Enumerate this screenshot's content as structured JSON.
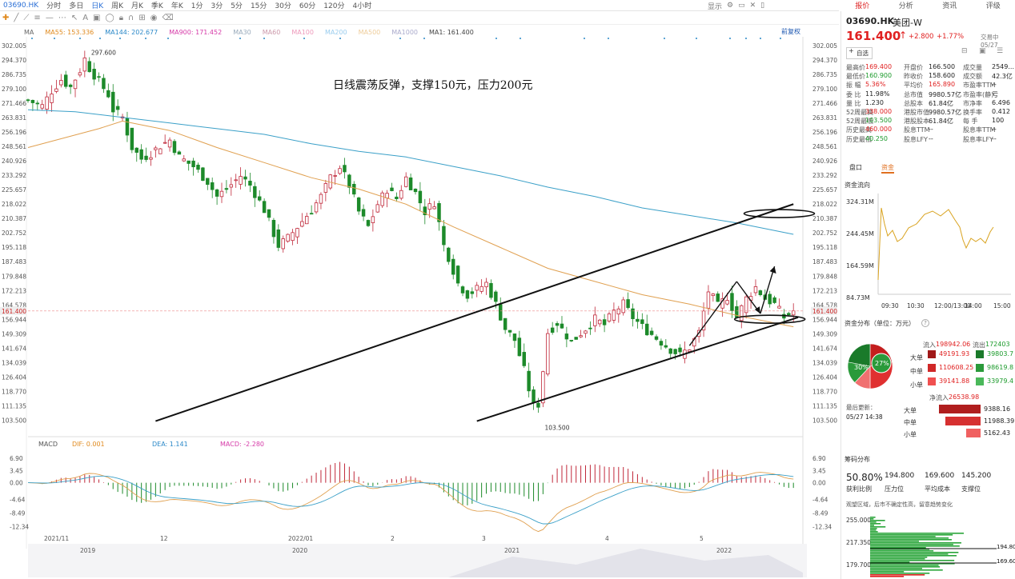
{
  "topbar": {
    "code": "03690.HK",
    "periods": [
      "分时",
      "多日",
      "日K",
      "周K",
      "月K",
      "季K",
      "年K",
      "1分",
      "3分",
      "5分",
      "15分",
      "30分",
      "60分",
      "120分",
      "4小时"
    ],
    "active_period": "日K",
    "right_menu": "显示",
    "panel_tabs": [
      "报价",
      "分析",
      "资讯",
      "评级"
    ]
  },
  "ma_bar": {
    "label": "MA",
    "items": [
      {
        "text": "MA55: 153.336",
        "color": "#e08a1e"
      },
      {
        "text": "MA144: 202.677",
        "color": "#2a88c8"
      },
      {
        "text": "MA900: 171.452",
        "color": "#d63aa8"
      },
      {
        "text": "MA30",
        "color": "#9ab"
      },
      {
        "text": "MA60",
        "color": "#c9a"
      },
      {
        "text": "MA100",
        "color": "#e9b"
      },
      {
        "text": "MA200",
        "color": "#9ce"
      },
      {
        "text": "MA500",
        "color": "#ec9"
      },
      {
        "text": "MA1000",
        "color": "#aac"
      },
      {
        "text": "MA1: 161.400",
        "color": "#444"
      }
    ],
    "adjust": "前复权"
  },
  "annotation": "日线震荡反弹，支撑150元，压力200元",
  "chart_data": [
    {
      "type": "candlestick",
      "title": "",
      "y_ticks": [
        302.005,
        294.37,
        286.735,
        279.1,
        271.466,
        263.831,
        256.196,
        248.561,
        240.926,
        233.292,
        225.657,
        218.022,
        210.387,
        202.752,
        195.118,
        187.483,
        179.848,
        172.213,
        164.578,
        156.944,
        149.309,
        141.674,
        134.039,
        126.404,
        118.77,
        111.135,
        103.5
      ],
      "ylim": [
        99,
        305
      ],
      "last_price": 161.4,
      "high_label": 297.6,
      "low_label": 103.5,
      "x_top_labels": [
        "2021/11",
        "12",
        "2022/01",
        "2",
        "3",
        "4",
        "5"
      ],
      "x_bottom_labels": [
        "2019",
        "2020",
        "2021",
        "2022"
      ],
      "close_path": [
        [
          0,
          273
        ],
        [
          3,
          270
        ],
        [
          5,
          278
        ],
        [
          7,
          284
        ],
        [
          9,
          280
        ],
        [
          11,
          289
        ],
        [
          12,
          295
        ],
        [
          13,
          290
        ],
        [
          15,
          283
        ],
        [
          17,
          276
        ],
        [
          18,
          268
        ],
        [
          20,
          264
        ],
        [
          22,
          248
        ],
        [
          24,
          242
        ],
        [
          26,
          245
        ],
        [
          28,
          249
        ],
        [
          30,
          252
        ],
        [
          32,
          243
        ],
        [
          35,
          238
        ],
        [
          38,
          230
        ],
        [
          40,
          222
        ],
        [
          42,
          226
        ],
        [
          45,
          233
        ],
        [
          47,
          228
        ],
        [
          50,
          215
        ],
        [
          53,
          196
        ],
        [
          55,
          200
        ],
        [
          57,
          206
        ],
        [
          60,
          215
        ],
        [
          62,
          222
        ],
        [
          64,
          232
        ],
        [
          66,
          238
        ],
        [
          68,
          228
        ],
        [
          70,
          214
        ],
        [
          72,
          206
        ],
        [
          74,
          218
        ],
        [
          76,
          226
        ],
        [
          78,
          221
        ],
        [
          80,
          232
        ],
        [
          82,
          224
        ],
        [
          84,
          214
        ],
        [
          86,
          219
        ],
        [
          87,
          208
        ],
        [
          88,
          196
        ],
        [
          89,
          190
        ],
        [
          90,
          183
        ],
        [
          91,
          176
        ],
        [
          93,
          170
        ],
        [
          95,
          173
        ],
        [
          97,
          176
        ],
        [
          99,
          165
        ],
        [
          101,
          152
        ],
        [
          103,
          146
        ],
        [
          105,
          130
        ],
        [
          106,
          120
        ],
        [
          107,
          111
        ],
        [
          108,
          112
        ],
        [
          109,
          130
        ],
        [
          110,
          150
        ],
        [
          112,
          155
        ],
        [
          115,
          145
        ],
        [
          118,
          152
        ],
        [
          120,
          157
        ],
        [
          122,
          154
        ],
        [
          124,
          161
        ],
        [
          126,
          165
        ],
        [
          128,
          158
        ],
        [
          130,
          153
        ],
        [
          132,
          149
        ],
        [
          134,
          145
        ],
        [
          136,
          141
        ],
        [
          138,
          138
        ],
        [
          140,
          142
        ],
        [
          142,
          150
        ],
        [
          144,
          172
        ],
        [
          146,
          164
        ],
        [
          148,
          169
        ],
        [
          150,
          158
        ],
        [
          152,
          168
        ],
        [
          154,
          174
        ],
        [
          156,
          168
        ],
        [
          158,
          165
        ],
        [
          160,
          158
        ],
        [
          162,
          161.4
        ]
      ],
      "ma55_path": [
        [
          0,
          248
        ],
        [
          15,
          258
        ],
        [
          20,
          262
        ],
        [
          30,
          257
        ],
        [
          40,
          248
        ],
        [
          50,
          240
        ],
        [
          60,
          232
        ],
        [
          70,
          226
        ],
        [
          80,
          218
        ],
        [
          90,
          206
        ],
        [
          100,
          195
        ],
        [
          110,
          184
        ],
        [
          120,
          177
        ],
        [
          130,
          170
        ],
        [
          140,
          165
        ],
        [
          150,
          159
        ],
        [
          162,
          153
        ]
      ],
      "ma144_path": [
        [
          0,
          268
        ],
        [
          10,
          267
        ],
        [
          20,
          264
        ],
        [
          30,
          261
        ],
        [
          40,
          258
        ],
        [
          50,
          255
        ],
        [
          60,
          250
        ],
        [
          70,
          246
        ],
        [
          80,
          243
        ],
        [
          90,
          238
        ],
        [
          100,
          233
        ],
        [
          110,
          227
        ],
        [
          120,
          222
        ],
        [
          130,
          216
        ],
        [
          140,
          212
        ],
        [
          150,
          208
        ],
        [
          162,
          202
        ]
      ],
      "trend_lines": [
        {
          "from": [
            27,
            103
          ],
          "to": [
            162,
            218
          ]
        },
        {
          "from": [
            95,
            103
          ],
          "to": [
            163,
            158
          ]
        },
        {
          "from": [
            140,
            143
          ],
          "to": [
            150,
            177
          ]
        },
        {
          "from": [
            150,
            177
          ],
          "to": [
            155,
            160
          ]
        },
        {
          "from": [
            155,
            160
          ],
          "to": [
            158,
            185
          ]
        }
      ],
      "ellipses": [
        {
          "center": [
            159,
            213
          ]
        },
        {
          "center": [
            157,
            157
          ]
        }
      ]
    },
    {
      "type": "macd",
      "header": {
        "label": "MACD",
        "dif": "DIF: 0.001",
        "dea": "DEA: 1.141",
        "macd": "MACD: -2.280"
      },
      "y_ticks": [
        6.9,
        3.45,
        0.0,
        -4.64,
        -8.49,
        -12.34
      ],
      "ylim": [
        -14,
        8
      ]
    }
  ],
  "panel": {
    "code": "03690.HK",
    "name": "美团-W",
    "price": "161.400",
    "change": "+2.800",
    "pct": "+1.77%",
    "trade_time": "交易中 05/27",
    "fav": "自选",
    "stats": [
      [
        "最高价",
        "169.400",
        "开盘价",
        "166.500",
        "成交量",
        "2549..."
      ],
      [
        "最低价",
        "160.900",
        "昨收价",
        "158.600",
        "成交额",
        "42.3亿"
      ],
      [
        "振    幅",
        "5.36%",
        "平均价",
        "165.890",
        "市盈率TTM",
        "--"
      ],
      [
        "委    比",
        "11.98%",
        "总市值",
        "9980.57亿",
        "市盈率(静)",
        "亏"
      ],
      [
        "量    比",
        "1.230",
        "总股本",
        "61.84亿",
        "市净率",
        "6.496"
      ],
      [
        "52周最高",
        "338.000",
        "港股市值",
        "9980.57亿",
        "换手率",
        "0.412"
      ],
      [
        "52周最低",
        "103.500",
        "港股股本",
        "61.84亿",
        "每    手",
        "100"
      ],
      [
        "历史最高",
        "460.000",
        "股息TTM",
        "--",
        "股息率TTM",
        "--"
      ],
      [
        "历史最低",
        "40.250",
        "股息LFY",
        "--",
        "股息率LFY",
        "--"
      ]
    ],
    "tabs2": [
      "盘口",
      "资金"
    ],
    "flow_title": "资金流向",
    "flow_y": [
      "324.31M",
      "244.45M",
      "164.59M",
      "84.73M"
    ],
    "flow_x": [
      "09:30",
      "10:30",
      "12:00/13:00",
      "14:00",
      "15:00"
    ],
    "dist_title": "资金分布（单位：万元）",
    "pie": {
      "outer_pct": "30%",
      "inner_pct": "27%"
    },
    "inflow_head": [
      "流入",
      "198942.06",
      "流出",
      "172403"
    ],
    "flows": [
      [
        "大单",
        "49191.93",
        "39803.7"
      ],
      [
        "中单",
        "110608.25",
        "98619.8"
      ],
      [
        "小单",
        "39141.88",
        "33979.4"
      ]
    ],
    "net_label": "净流入",
    "net_value": "26538.98",
    "update_label": "最后更新：",
    "update_time": "05/27 14:38",
    "net_rows": [
      [
        "大单",
        "9388.16"
      ],
      [
        "中单",
        "11988.39"
      ],
      [
        "小单",
        "5162.43"
      ]
    ],
    "chip_title": "筹码分布",
    "chip_vals": [
      "50.80%",
      "194.800",
      "169.600",
      "145.200"
    ],
    "chip_labels": [
      "获利比例",
      "压力位",
      "平均成本",
      "支撑位"
    ],
    "chip_note": "观望区域，后市不确定性高，留意趋势变化",
    "chip_y": [
      "255.000",
      "217.350",
      "179.700"
    ],
    "chip_marks": [
      "194.80",
      "169.60"
    ]
  }
}
